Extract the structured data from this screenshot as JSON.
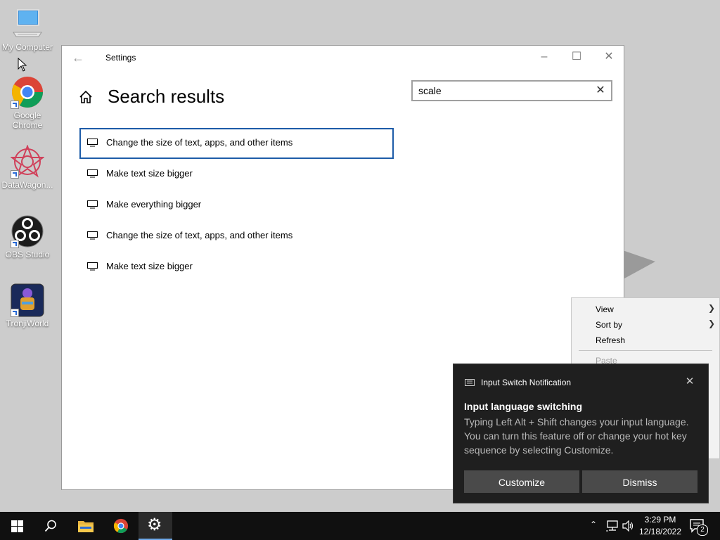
{
  "desktop": {
    "icons": [
      {
        "label": "My Computer"
      },
      {
        "label": "Google Chrome"
      },
      {
        "label": "DataWagon..."
      },
      {
        "label": "OBS Studio"
      },
      {
        "label": "TronjiWorld"
      }
    ]
  },
  "settings_window": {
    "title": "Settings",
    "page_title": "Search results",
    "search": {
      "value": "scale",
      "placeholder": ""
    },
    "results": [
      {
        "label": "Change the size of text, apps, and other items"
      },
      {
        "label": "Make text size bigger"
      },
      {
        "label": "Make everything bigger"
      },
      {
        "label": "Change the size of text, apps, and other items"
      },
      {
        "label": "Make text size bigger"
      }
    ]
  },
  "context_menu": {
    "items": [
      {
        "label": "View",
        "has_submenu": true
      },
      {
        "label": "Sort by",
        "has_submenu": true
      },
      {
        "label": "Refresh",
        "has_submenu": false
      },
      {
        "label": "Paste",
        "disabled": true
      }
    ]
  },
  "notification": {
    "app_name": "Input Switch Notification",
    "title": "Input language switching",
    "body": "Typing Left Alt + Shift changes your input language. You can turn this feature off or change your hot key sequence by selecting Customize.",
    "buttons": {
      "customize": "Customize",
      "dismiss": "Dismiss"
    }
  },
  "taskbar": {
    "pinned": [
      "start-icon",
      "search-icon",
      "file-explorer-icon",
      "chrome-icon",
      "settings-icon"
    ],
    "active": "settings-icon",
    "clock": {
      "time": "3:29 PM",
      "date": "12/18/2022"
    },
    "notification_count": "2"
  },
  "colors": {
    "desktop_bg": "#cccccc",
    "focus_border": "#1d5ca8",
    "taskbar_bg": "#101010",
    "toast_bg": "#1f1f1f"
  }
}
